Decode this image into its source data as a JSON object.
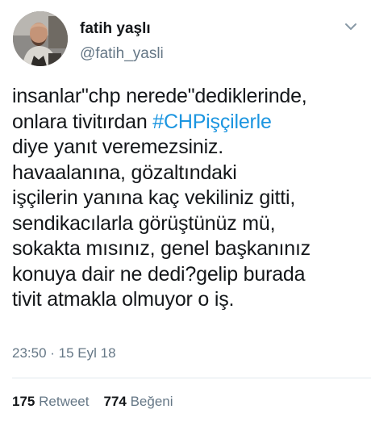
{
  "user": {
    "display_name": "fatih yaşlı",
    "handle": "@fatih_yasli",
    "avatar_icon": "profile-photo"
  },
  "tweet": {
    "lines": [
      {
        "text": "insanlar\"chp nerede\"dediklerinde,"
      },
      {
        "before": "onlara tivitırdan  ",
        "hashtag": "#CHPişçilerle"
      },
      {
        "text": "diye yanıt veremezsiniz."
      },
      {
        "text": "havaalanına, gözaltındaki"
      },
      {
        "text": "işçilerin yanına kaç vekiliniz gitti,"
      },
      {
        "text": "sendikacılarla görüştünüz mü,"
      },
      {
        "text": "sokakta mısınız, genel başkanınız"
      },
      {
        "text": "konuya dair ne dedi?gelip burada"
      },
      {
        "text": "tivit atmakla olmuyor o iş."
      }
    ],
    "hashtag_color": "#1b95e0",
    "timestamp": "23:50 · 15 Eyl 18"
  },
  "stats": {
    "retweets_count": "175",
    "retweets_label": "Retweet",
    "likes_count": "774",
    "likes_label": "Beğeni"
  },
  "menu_icon": "chevron-down-icon"
}
